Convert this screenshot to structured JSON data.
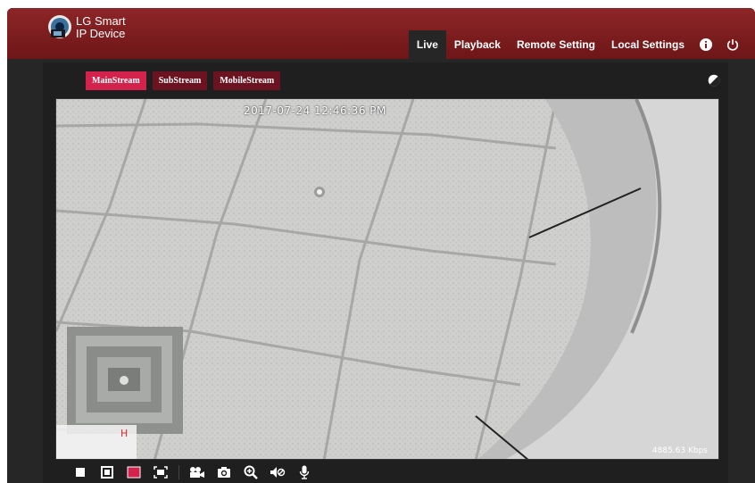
{
  "brand": {
    "line1": "LG Smart",
    "line2": "IP Device"
  },
  "nav": {
    "tabs": [
      {
        "label": "Live",
        "active": true
      },
      {
        "label": "Playback"
      },
      {
        "label": "Remote Setting"
      },
      {
        "label": "Local Settings"
      }
    ],
    "icons": [
      "info-icon",
      "power-icon"
    ]
  },
  "streams": {
    "tabs": [
      {
        "label": "MainStream",
        "active": true
      },
      {
        "label": "SubStream"
      },
      {
        "label": "MobileStream"
      }
    ]
  },
  "video": {
    "timestamp": "2017-07-24 12:46:36 PM",
    "channel_mark": "H",
    "bitrate": "4885.63 Kbps"
  },
  "toolbar": {
    "icons": [
      "layout-1-icon",
      "layout-2-icon",
      "layout-active-icon",
      "fullscreen-icon",
      "record-icon",
      "snapshot-icon",
      "zoom-icon",
      "mute-icon",
      "microphone-icon"
    ]
  },
  "colors": {
    "header": "#7d1c1e",
    "accent": "#d3224b",
    "dark": "#262626"
  }
}
